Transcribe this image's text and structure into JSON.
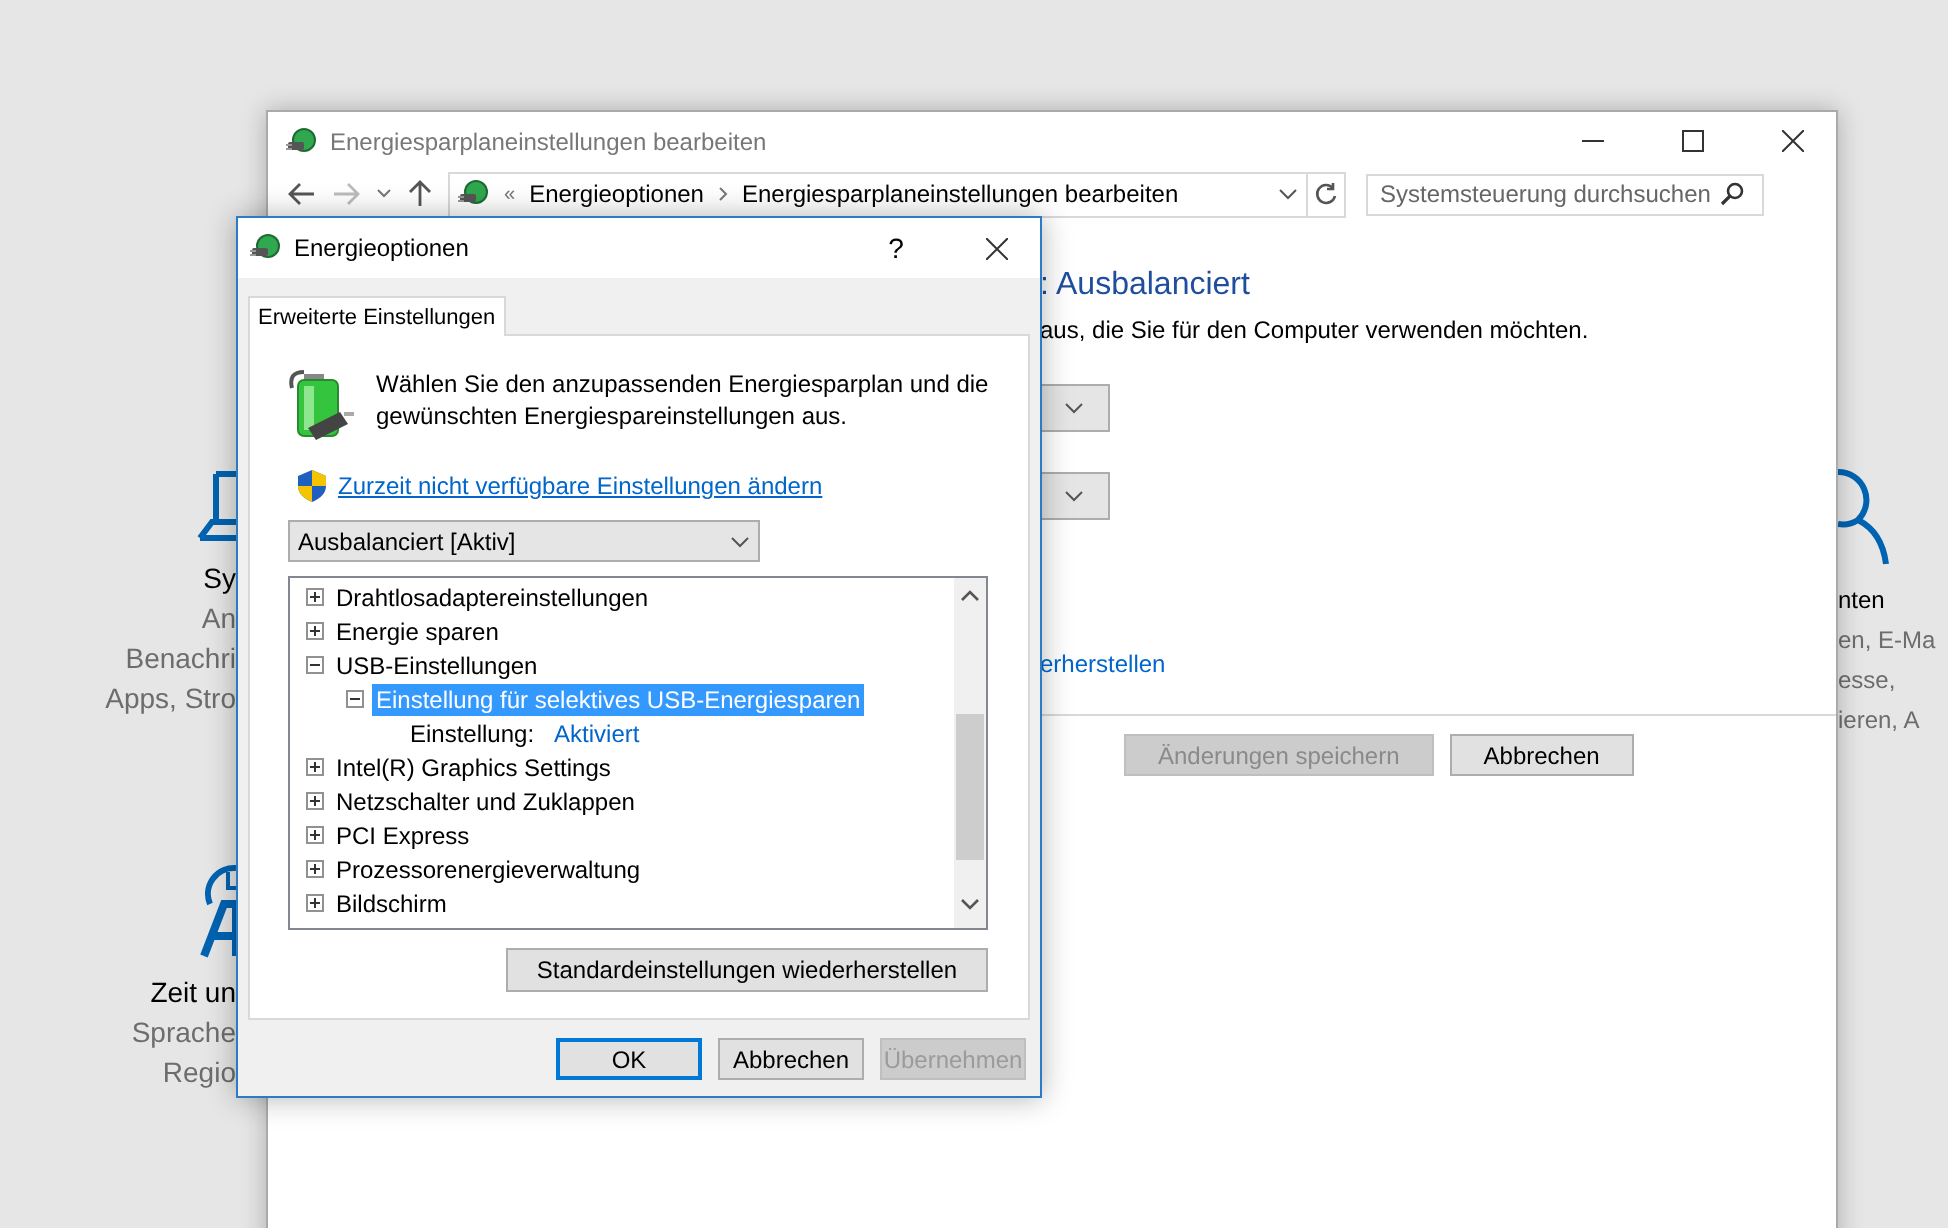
{
  "left_tiles": [
    {
      "kind": "laptop",
      "title": "Sy",
      "lines": [
        "An",
        "Benachri",
        "Apps, Stro"
      ]
    },
    {
      "kind": "clock",
      "title": "Zeit un",
      "lines": [
        "Sprache",
        "Regio"
      ]
    }
  ],
  "right_tiles": [
    {
      "kind": "person",
      "title": "nten",
      "lines": [
        "en, E-Ma",
        "esse,",
        "ieren, A"
      ]
    }
  ],
  "plan_window": {
    "title": "Energiesparplaneinstellungen bearbeiten",
    "overflow_mark": "«",
    "breadcrumb": [
      "Energieoptionen",
      "Energiesparplaneinstellungen bearbeiten"
    ],
    "search": {
      "placeholder": "Systemsteuerung durchsuchen"
    },
    "heading": ": Ausbalanciert",
    "description": "aus, die Sie für den Computer verwenden möchten.",
    "link": "erherstellen",
    "buttons": [
      {
        "label": "Änderungen speichern",
        "disabled": true
      },
      {
        "label": "Abbrechen",
        "disabled": false
      }
    ]
  },
  "dialog": {
    "title": "Energieoptionen",
    "help": "?",
    "tabs": [
      {
        "label": "Erweiterte Einstellungen",
        "selected": true
      }
    ],
    "intro": "Wählen Sie den anzupassenden Energiesparplan und die gewünschten Energiespareinstellungen aus.",
    "admin_link": "Zurzeit nicht verfügbare Einstellungen ändern",
    "plan_select": {
      "value": "Ausbalanciert [Aktiv]"
    },
    "tree": [
      {
        "label": "Drahtlosadaptereinstellungen",
        "expanded": false,
        "selected": false
      },
      {
        "label": "Energie sparen",
        "expanded": false,
        "selected": false
      },
      {
        "label": "USB-Einstellungen",
        "expanded": true,
        "selected": false,
        "children": [
          {
            "label": "Einstellung für selektives USB-Energiesparen",
            "expanded": true,
            "selected": true,
            "children": [
              {
                "kind": "setting",
                "label": "Einstellung:",
                "value": "Aktiviert",
                "selected": false
              }
            ]
          }
        ]
      },
      {
        "label": "Intel(R) Graphics Settings",
        "expanded": false,
        "selected": false
      },
      {
        "label": "Netzschalter und Zuklappen",
        "expanded": false,
        "selected": false
      },
      {
        "label": "PCI Express",
        "expanded": false,
        "selected": false
      },
      {
        "label": "Prozessorenergieverwaltung",
        "expanded": false,
        "selected": false
      },
      {
        "label": "Bildschirm",
        "expanded": false,
        "selected": false
      }
    ],
    "restore_button": "Standardeinstellungen wiederherstellen",
    "buttons": [
      {
        "label": "OK",
        "default": true,
        "disabled": false
      },
      {
        "label": "Abbrechen",
        "default": false,
        "disabled": false
      },
      {
        "label": "Übernehmen",
        "default": false,
        "disabled": true
      }
    ]
  }
}
